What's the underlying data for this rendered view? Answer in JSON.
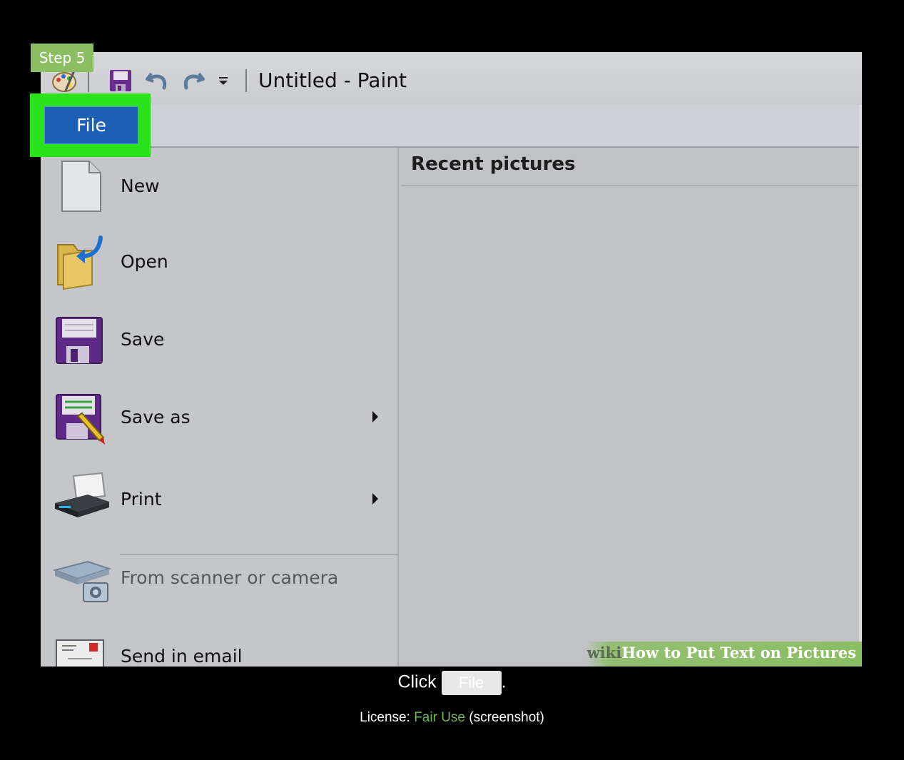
{
  "window": {
    "title": "Untitled - Paint",
    "step_badge": "Step 5"
  },
  "file_tab": {
    "label": "File"
  },
  "menu": {
    "items": [
      {
        "label": "New",
        "enabled": true,
        "submenu": false,
        "icon": "new-document-icon"
      },
      {
        "label": "Open",
        "enabled": true,
        "submenu": false,
        "icon": "open-folder-icon"
      },
      {
        "label": "Save",
        "enabled": true,
        "submenu": false,
        "icon": "save-disk-icon"
      },
      {
        "label": "Save as",
        "enabled": true,
        "submenu": true,
        "icon": "save-as-icon"
      },
      {
        "label": "Print",
        "enabled": true,
        "submenu": true,
        "icon": "printer-icon"
      },
      {
        "label": "From scanner or camera",
        "enabled": false,
        "submenu": false,
        "icon": "scanner-camera-icon"
      },
      {
        "label": "Send in email",
        "enabled": true,
        "submenu": false,
        "icon": "email-icon"
      }
    ]
  },
  "recent": {
    "title": "Recent pictures"
  },
  "watermark": {
    "brand": "wiki",
    "text": "How to Put Text on Pictures"
  },
  "caption": {
    "text": "Click",
    "button_label": "File",
    "suffix": "."
  },
  "license": {
    "prefix": "License:",
    "link": "Fair Use",
    "suffix": "(screenshot)"
  },
  "colors": {
    "accent_green": "#2ae21a",
    "file_blue": "#1c5fb4",
    "wikihow_green": "#8cbe64"
  }
}
